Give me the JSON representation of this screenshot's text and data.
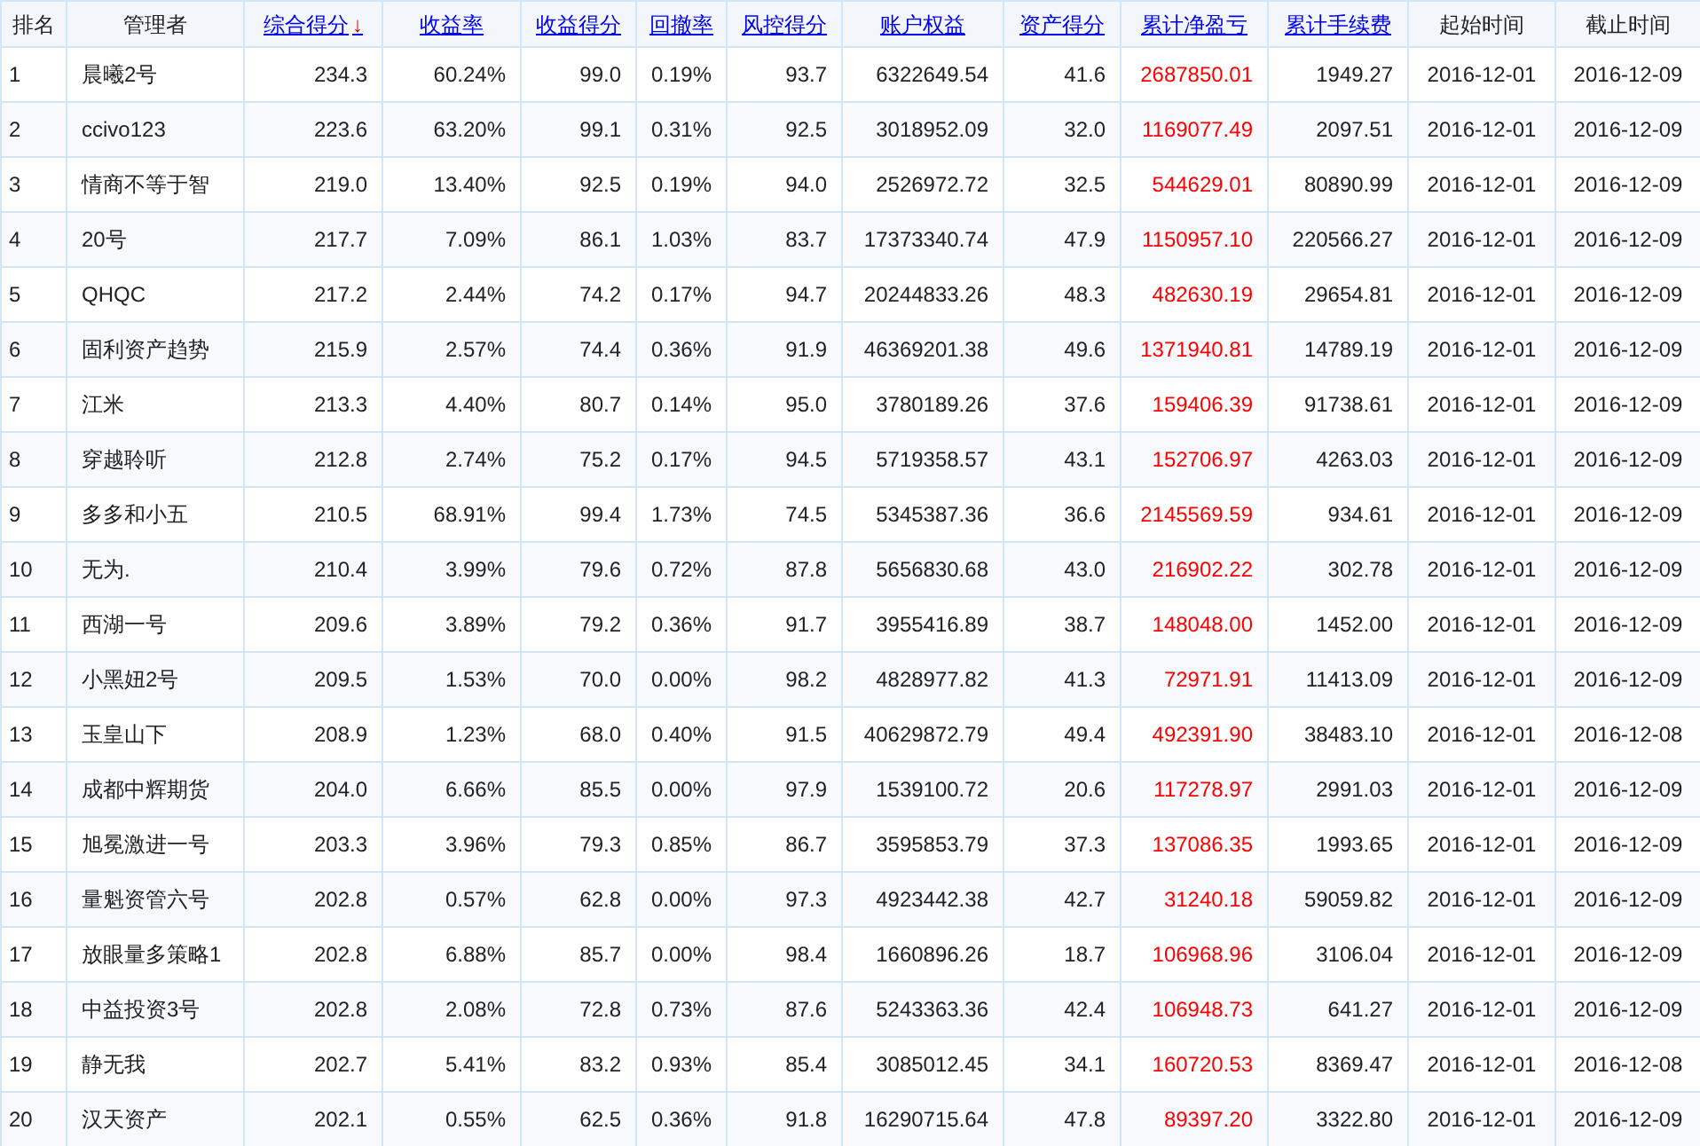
{
  "table": {
    "columns": [
      {
        "label": "排名",
        "kind": "rank",
        "link": false
      },
      {
        "label": "管理者",
        "kind": "name",
        "link": false
      },
      {
        "label": "综合得分",
        "kind": "number",
        "link": true,
        "sort_mark": "↓"
      },
      {
        "label": "收益率",
        "kind": "number",
        "link": true
      },
      {
        "label": "收益得分",
        "kind": "number",
        "link": true
      },
      {
        "label": "回撤率",
        "kind": "number",
        "link": true
      },
      {
        "label": "风控得分",
        "kind": "number",
        "link": true
      },
      {
        "label": "账户权益",
        "kind": "number",
        "link": true
      },
      {
        "label": "资产得分",
        "kind": "number",
        "link": true
      },
      {
        "label": "累计净盈亏",
        "kind": "loss",
        "link": true
      },
      {
        "label": "累计手续费",
        "kind": "number",
        "link": true
      },
      {
        "label": "起始时间",
        "kind": "date",
        "link": false
      },
      {
        "label": "截止时间",
        "kind": "date",
        "link": false
      }
    ],
    "rows": [
      [
        "1",
        "晨曦2号",
        "234.3",
        "60.24%",
        "99.0",
        "0.19%",
        "93.7",
        "6322649.54",
        "41.6",
        "2687850.01",
        "1949.27",
        "2016-12-01",
        "2016-12-09"
      ],
      [
        "2",
        "ccivo123",
        "223.6",
        "63.20%",
        "99.1",
        "0.31%",
        "92.5",
        "3018952.09",
        "32.0",
        "1169077.49",
        "2097.51",
        "2016-12-01",
        "2016-12-09"
      ],
      [
        "3",
        "情商不等于智",
        "219.0",
        "13.40%",
        "92.5",
        "0.19%",
        "94.0",
        "2526972.72",
        "32.5",
        "544629.01",
        "80890.99",
        "2016-12-01",
        "2016-12-09"
      ],
      [
        "4",
        "20号",
        "217.7",
        "7.09%",
        "86.1",
        "1.03%",
        "83.7",
        "17373340.74",
        "47.9",
        "1150957.10",
        "220566.27",
        "2016-12-01",
        "2016-12-09"
      ],
      [
        "5",
        "QHQC",
        "217.2",
        "2.44%",
        "74.2",
        "0.17%",
        "94.7",
        "20244833.26",
        "48.3",
        "482630.19",
        "29654.81",
        "2016-12-01",
        "2016-12-09"
      ],
      [
        "6",
        "固利资产趋势",
        "215.9",
        "2.57%",
        "74.4",
        "0.36%",
        "91.9",
        "46369201.38",
        "49.6",
        "1371940.81",
        "14789.19",
        "2016-12-01",
        "2016-12-09"
      ],
      [
        "7",
        "江米",
        "213.3",
        "4.40%",
        "80.7",
        "0.14%",
        "95.0",
        "3780189.26",
        "37.6",
        "159406.39",
        "91738.61",
        "2016-12-01",
        "2016-12-09"
      ],
      [
        "8",
        "穿越聆听",
        "212.8",
        "2.74%",
        "75.2",
        "0.17%",
        "94.5",
        "5719358.57",
        "43.1",
        "152706.97",
        "4263.03",
        "2016-12-01",
        "2016-12-09"
      ],
      [
        "9",
        "多多和小五",
        "210.5",
        "68.91%",
        "99.4",
        "1.73%",
        "74.5",
        "5345387.36",
        "36.6",
        "2145569.59",
        "934.61",
        "2016-12-01",
        "2016-12-09"
      ],
      [
        "10",
        "无为.",
        "210.4",
        "3.99%",
        "79.6",
        "0.72%",
        "87.8",
        "5656830.68",
        "43.0",
        "216902.22",
        "302.78",
        "2016-12-01",
        "2016-12-09"
      ],
      [
        "11",
        "西湖一号",
        "209.6",
        "3.89%",
        "79.2",
        "0.36%",
        "91.7",
        "3955416.89",
        "38.7",
        "148048.00",
        "1452.00",
        "2016-12-01",
        "2016-12-09"
      ],
      [
        "12",
        "小黑妞2号",
        "209.5",
        "1.53%",
        "70.0",
        "0.00%",
        "98.2",
        "4828977.82",
        "41.3",
        "72971.91",
        "11413.09",
        "2016-12-01",
        "2016-12-09"
      ],
      [
        "13",
        "玉皇山下",
        "208.9",
        "1.23%",
        "68.0",
        "0.40%",
        "91.5",
        "40629872.79",
        "49.4",
        "492391.90",
        "38483.10",
        "2016-12-01",
        "2016-12-08"
      ],
      [
        "14",
        "成都中辉期货",
        "204.0",
        "6.66%",
        "85.5",
        "0.00%",
        "97.9",
        "1539100.72",
        "20.6",
        "117278.97",
        "2991.03",
        "2016-12-01",
        "2016-12-09"
      ],
      [
        "15",
        "旭冕激进一号",
        "203.3",
        "3.96%",
        "79.3",
        "0.85%",
        "86.7",
        "3595853.79",
        "37.3",
        "137086.35",
        "1993.65",
        "2016-12-01",
        "2016-12-09"
      ],
      [
        "16",
        "量魁资管六号",
        "202.8",
        "0.57%",
        "62.8",
        "0.00%",
        "97.3",
        "4923442.38",
        "42.7",
        "31240.18",
        "59059.82",
        "2016-12-01",
        "2016-12-09"
      ],
      [
        "17",
        "放眼量多策略1",
        "202.8",
        "6.88%",
        "85.7",
        "0.00%",
        "98.4",
        "1660896.26",
        "18.7",
        "106968.96",
        "3106.04",
        "2016-12-01",
        "2016-12-09"
      ],
      [
        "18",
        "中益投资3号",
        "202.8",
        "2.08%",
        "72.8",
        "0.73%",
        "87.6",
        "5243363.36",
        "42.4",
        "106948.73",
        "641.27",
        "2016-12-01",
        "2016-12-09"
      ],
      [
        "19",
        "静无我",
        "202.7",
        "5.41%",
        "83.2",
        "0.93%",
        "85.4",
        "3085012.45",
        "34.1",
        "160720.53",
        "8369.47",
        "2016-12-01",
        "2016-12-08"
      ],
      [
        "20",
        "汉天资产",
        "202.1",
        "0.55%",
        "62.5",
        "0.36%",
        "91.8",
        "16290715.64",
        "47.8",
        "89397.20",
        "3322.80",
        "2016-12-01",
        "2016-12-09"
      ]
    ]
  }
}
